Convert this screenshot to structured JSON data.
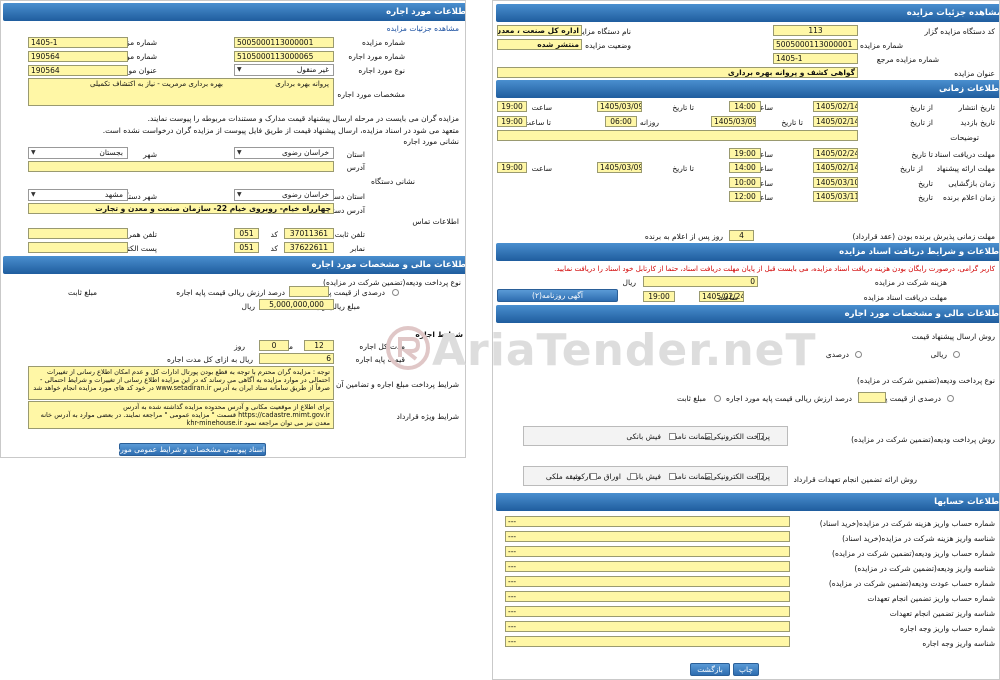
{
  "left": {
    "header": "اطلاعات مورد اجاره",
    "breadcrumb": "مشاهده جزئیات مزایده",
    "fields": {
      "tender_no_label": "شماره مزایده",
      "tender_no": "5005000113000001",
      "ref_tender_label": "شماره مزایده مرجع",
      "ref_tender": "1405-1",
      "lease_no_label": "شماره مورد اجاره",
      "lease_no": "5105000113000065",
      "ref_lease_label": "شماره مورد اجاره مرجع",
      "ref_lease": "190564",
      "lease_type_label": "نوع مورد اجاره",
      "lease_type": "غیر منقول",
      "lease_title_label": "عنوان مورد اجاره",
      "lease_title": "190564",
      "spec_label": "مشخصات مورد اجاره",
      "spec_line1": "پروانه بهره برداری",
      "spec_line2": "بهره برداری مرمریت - نیاز به اکتشاف تکمیلی"
    },
    "notes": {
      "note1": "مزایده گران می بایست در مرحله ارسال پیشنهاد قیمت مدارک و مستندات مربوطه را پیوست نمایند.",
      "note2": "متعهد می شود در اسناد مزایده، ارسال پیشنهاد قیمت از طریق فایل پیوست از مزایده گران درخواست نشده است.",
      "address_section": "نشانی مورد اجاره"
    },
    "location": {
      "province_label": "استان",
      "province": "خراسان رضوی",
      "city_label": "شهر",
      "city": "بجستان",
      "address_label": "آدرس"
    },
    "agency": {
      "section": "نشانی دستگاه",
      "province_label": "استان دستگاه",
      "province": "خراسان رضوی",
      "city_label": "شهر دستگاه",
      "city": "مشهد",
      "address_label": "آدرس دستگاه",
      "address": "چهارراه خیام- روبروی خیام 22- سازمان صنعت و معدن و تجارت",
      "contact_section": "اطلاعات تماس",
      "phone_label": "تلفن ثابت",
      "phone_code_label": "کد",
      "phone_code": "051",
      "phone": "37011361",
      "mobile_label": "تلفن همراه",
      "fax_label": "نمابر",
      "fax_code_label": "کد",
      "fax_code": "051",
      "fax": "37622611",
      "email_label": "پست الکترونیکی"
    },
    "financial": {
      "header": "اطلاعات مالی و مشخصات مورد اجاره",
      "deposit_type_label": "نوع پرداخت ودیعه(تضمین شرکت در مزایده)",
      "opt_percent": "درصدی از قیمت پایه",
      "opt_percent_value_label": "درصد ارزش ریالی قیمت پایه اجاره",
      "opt_fixed": "مبلغ ثابت",
      "deposit_amount_label": "مبلغ ریالی ودیعه",
      "deposit_amount": "5,000,000,000",
      "deposit_unit": "ریال"
    },
    "lease_terms": {
      "section": "شرایط اجاره",
      "duration_label": "مدت کل اجاره",
      "months": "12",
      "month_unit": "ماه",
      "days": "0",
      "day_unit": "روز",
      "base_price_label": "قیمت پایه اجاره",
      "base_price": "6",
      "base_unit": "ریال به ازای کل مدت اجاره",
      "guarantee_label": "شرایط پرداخت مبلغ اجاره و تضامین آن",
      "guarantee_text": "توجه : مزایده گران محترم با توجه به قطع بودن پورتال ادارات کل و عدم امکان اطلاع رسانی از تغییرات احتمالی در موارد مزایده به آگاهی می رساند که در این مزایده اطلاع رسانی از تغییرات و شرایط احتمالی - صرفاً از طریق سامانه ستاد ایران به آدرس www.setadiran.ir در خود کد های مورد مزایده انجام خواهد شد",
      "special_label": "شرایط ویژه قرارداد",
      "special_text": "برای اطلاع از موقعیت مکانی و آدرس محدوده مزایده گذاشته شده به آدرس https://cadastre.mimt.gov.ir قسمت \" مزایده عمومی \" مراجعه نمایند. در بعضی موارد به آدرس خانه معدن نیز می توان مراجعه نمود khr-minehouse.ir",
      "attach_button": "اسناد پیوستی مشخصات و شرایط عمومی مورد اجاره(۰)"
    }
  },
  "right": {
    "header": "مشاهده جزئیات مزایده",
    "org_code_label": "کد دستگاه مزایده گزار",
    "org_code": "113",
    "org_name_label": "نام دستگاه مزایده گزار",
    "org_name": "اداره کل صنعت ، معدن و تجا",
    "tender_no_label": "شماره مزایده",
    "tender_no": "5005000113000001",
    "status_label": "وضعیت مزایده",
    "status": "منتشر شده",
    "ref_label": "شماره مزایده مرجع",
    "ref": "1405-1",
    "title_label": "عنوان مزایده",
    "title": "گواهی کشف و پروانه بهره برداری",
    "timing": {
      "header": "اطلاعات زمانی",
      "publish_label": "تاریخ انتشار",
      "from": "از تاریخ",
      "to": "تا تاریخ",
      "time": "ساعت",
      "publish_from": "1405/02/14",
      "publish_from_time": "14:00",
      "publish_to": "1405/03/09",
      "publish_to_time": "19:00",
      "visit_label": "تاریخ بازدید",
      "visit_from": "1405/02/14",
      "visit_to": "1405/03/09",
      "visit_from_time_label": "روزانه از ساعت",
      "visit_from_time": "06:00",
      "visit_to_time_label": "تا ساعت",
      "visit_to_time": "19:00",
      "desc_label": "توضیحات",
      "doc_deadline_label": "مهلت دریافت اسناد",
      "doc_deadline": "1405/02/24",
      "doc_deadline_time": "19:00",
      "bid_deadline_label": "مهلت ارائه پیشنهاد",
      "bid_from": "1405/02/14",
      "bid_from_time": "14:00",
      "bid_to": "1405/03/09",
      "bid_to_time": "19:00",
      "opening_label": "زمان بازگشایی",
      "date": "تاریخ",
      "opening": "1405/03/10",
      "opening_time": "10:00",
      "announce_label": "زمان اعلام برنده",
      "announce": "1405/03/11",
      "announce_time": "12:00",
      "validity_label": "مهلت زمانی پذیرش برنده بودن (عقد قرارداد)",
      "validity": "4",
      "validity_unit": "روز پس از اعلام به برنده"
    },
    "docs": {
      "header": "اطلاعات و شرایط دریافت اسناد مزایده",
      "warning": "کاربر گرامی، درصورت رایگان بودن هزینه دریافت اسناد مزایده، می بایست قبل از پایان مهلت دریافت اسناد، حتما از کارتابل خود اسناد را دریافت نمایید.",
      "fee_label": "هزینه شرکت در مزایده",
      "fee": "0",
      "fee_unit": "ریال",
      "deadline_label": "مهلت دریافت اسناد مزایده",
      "deadline": "1405/02/24",
      "time": "ساعت",
      "deadline_time": "19:00",
      "news_button": "آگهی روزنامه(۲)"
    },
    "financial": {
      "header": "اطلاعات مالی و مشخصات مورد اجاره",
      "bid_method_label": "روش ارسال پیشنهاد قیمت",
      "rial": "ریالی",
      "percent": "درصدی",
      "deposit_type_label": "نوع پرداخت ودیعه(تضمین شرکت در مزایده)",
      "pct_label": "درصدی از قیمت پایه",
      "pct_value_label": "درصد ارزش ریالی قیمت پایه مورد اجاره",
      "fixed": "مبلغ ثابت",
      "deposit_method_label": "روش پرداخت ودیعه(تضمین شرکت در مزایده)",
      "m1": [
        "پرداخت الکترونیکی",
        "ضمانت نامه",
        "فیش بانکی"
      ],
      "contract_method_label": "روش ارائه تضمین انجام تعهدات قرارداد",
      "m2": [
        "پرداخت الکترونیکی",
        "ضمانت نامه",
        "فیش بانکی",
        "اوراق مشارکت",
        "وثیقه ملکی"
      ]
    },
    "accounts": {
      "header": "اطلاعات حسابها",
      "rows": [
        {
          "label": "شماره حساب واریز هزینه شرکت در مزایده(خرید اسناد)",
          "value": "---"
        },
        {
          "label": "شناسه واریز هزینه شرکت در مزایده(خرید اسناد)",
          "value": "---"
        },
        {
          "label": "شماره حساب واریز ودیعه(تضمین شرکت در مزایده)",
          "value": "---"
        },
        {
          "label": "شناسه واریز ودیعه(تضمین شرکت در مزایده)",
          "value": "---"
        },
        {
          "label": "شماره حساب عودت ودیعه(تضمین شرکت در مزایده)",
          "value": "---"
        },
        {
          "label": "شماره حساب واریز تضمین انجام تعهدات",
          "value": "---"
        },
        {
          "label": "شناسه واریز تضمین انجام تعهدات",
          "value": "---"
        },
        {
          "label": "شماره حساب واریز وجه اجاره",
          "value": "---"
        },
        {
          "label": "شناسه واریز وجه اجاره",
          "value": "---"
        }
      ]
    },
    "print_button": "چاپ",
    "back_button": "بازگشت"
  },
  "watermark": "AriaTender.neT"
}
